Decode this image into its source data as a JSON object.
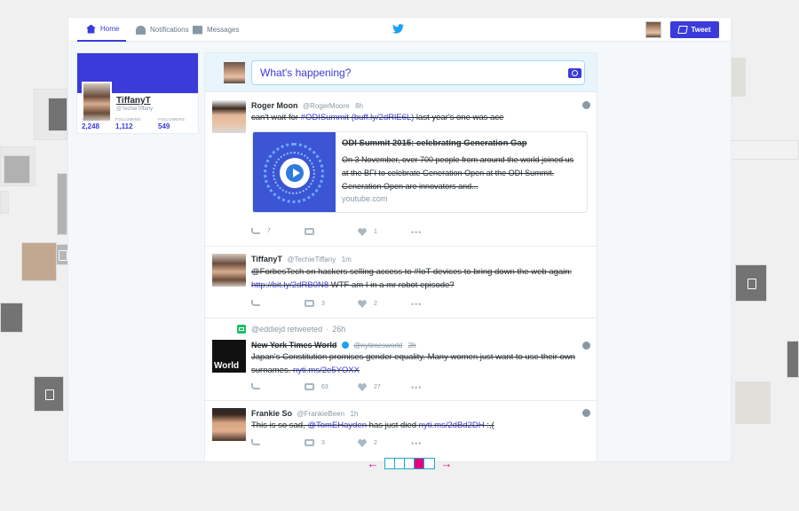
{
  "nav": {
    "home": "Home",
    "notifications": "Notifications",
    "messages": "Messages",
    "tweet_button": "Tweet"
  },
  "profile": {
    "name": "TiffanyT",
    "handle": "@TechieTiffany",
    "stats": [
      {
        "label": "TWEETS",
        "value": "2,248"
      },
      {
        "label": "FOLLOWING",
        "value": "1,112"
      },
      {
        "label": "FOLLOWERS",
        "value": "549"
      }
    ]
  },
  "compose": {
    "placeholder": "What's happening?"
  },
  "tweets": [
    {
      "name": "Roger Moon",
      "handle": "@RogerMoore",
      "time": "8h",
      "text_pre": "can't wait for ",
      "text_link1": "#ODISummit",
      "text_link2": "(buff.ly/2dRlE6L)",
      "text_post": " last year's one was ace",
      "card_title": "ODI Summit 2015: celebrating Generation Gap",
      "card_desc": "On 3 November, over 700 people from around the world joined us at the BFI to celebrate Generation Open at the ODI Summit. Generation Open are innovators and...",
      "card_domain": "youtube.com",
      "replies": "7",
      "retweets": "",
      "likes": "1"
    },
    {
      "name": "TiffanyT",
      "handle": "@TechieTiffany",
      "time": "1m",
      "text_pre": "@ForbesTech on hackers selling access to #IoT devices to bring down the web again: ",
      "text_link": "http://bit.ly/2dRB0N8",
      "text_post": " WTF am I in a mr robot episode?",
      "replies": "",
      "retweets": "3",
      "likes": "2"
    },
    {
      "retweeted_by": "@eddiejd retweeted",
      "retweet_time": "26h",
      "name": "New York Times World",
      "handle": "@nytimesworld",
      "time": "2h",
      "avatar_text": "World",
      "text_pre": "Japan's Constitution promises gender equality. Many women just want to use their own surnames. ",
      "text_link": "nyti.ms/2e5YOXX",
      "replies": "",
      "retweets": "63",
      "likes": "27"
    },
    {
      "name": "Frankie So",
      "handle": "@FrankieBeen",
      "time": "1h",
      "text_pre": "This is so sad, ",
      "text_link1": "@TomEHayden",
      "text_mid": " has just died ",
      "text_link2": "nyti.ms/2dBd2DH",
      "text_post": " :,(",
      "replies": "",
      "retweets": "3",
      "likes": "2"
    }
  ],
  "pager": {
    "pages": 5,
    "active": 4,
    "prev": "←",
    "next": "→"
  },
  "colors": {
    "accent": "#3b3bdc",
    "pager": "#e5007d"
  }
}
